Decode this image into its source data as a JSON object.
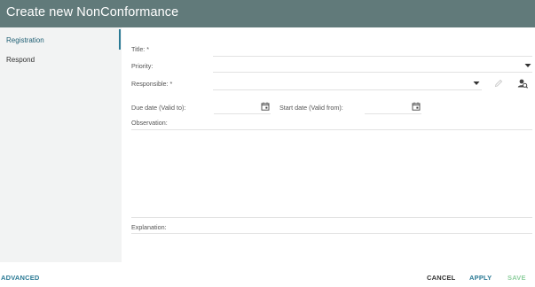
{
  "header": {
    "title": "Create new NonConformance"
  },
  "sidebar": {
    "items": [
      {
        "label": "Registration"
      },
      {
        "label": "Respond"
      }
    ]
  },
  "form": {
    "title_label": "Title: *",
    "priority_label": "Priority:",
    "responsible_label": "Responsible: *",
    "due_date_label": "Due date (Valid to):",
    "start_date_label": "Start date (Valid from):",
    "observation_label": "Observation:",
    "explanation_label": "Explanation:"
  },
  "footer": {
    "advanced_label": "ADVANCED",
    "cancel_label": "CANCEL",
    "apply_label": "APPLY",
    "save_label": "SAVE"
  },
  "icons": {
    "dropdown": "chevron-down-icon",
    "edit": "pencil-icon",
    "user_search": "user-search-icon",
    "calendar": "calendar-icon"
  },
  "colors": {
    "header_bg": "#617a7a",
    "accent": "#2b7a95",
    "save_disabled": "#8fcf9f"
  }
}
